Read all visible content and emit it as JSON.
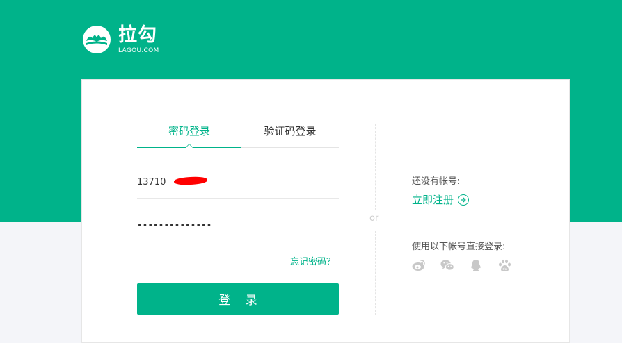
{
  "brand": {
    "name_cn": "拉勾",
    "name_en": "LAGOU.COM",
    "logo_icon": "lagou-logo-icon"
  },
  "colors": {
    "brand_green": "#00b38a",
    "background": "#f4f5f9",
    "card": "#ffffff",
    "text_dark": "#333333",
    "text_muted": "#bbbbbb",
    "redaction": "#ff0000"
  },
  "login_tabs": [
    {
      "label": "密码登录",
      "active": true
    },
    {
      "label": "验证码登录",
      "active": false
    }
  ],
  "form": {
    "phone_value": "13710",
    "phone_redacted": true,
    "password_value": "••••••••••••••",
    "forgot_label": "忘记密码？",
    "login_button": "登 录"
  },
  "divider": {
    "or_label": "or"
  },
  "side": {
    "no_account_text": "还没有帐号:",
    "register_link": "立即注册",
    "register_icon": "arrow-right-circle-icon",
    "other_login_text": "使用以下帐号直接登录:",
    "social_icons": [
      "weibo-icon",
      "wechat-icon",
      "qq-icon",
      "baidu-icon"
    ]
  }
}
